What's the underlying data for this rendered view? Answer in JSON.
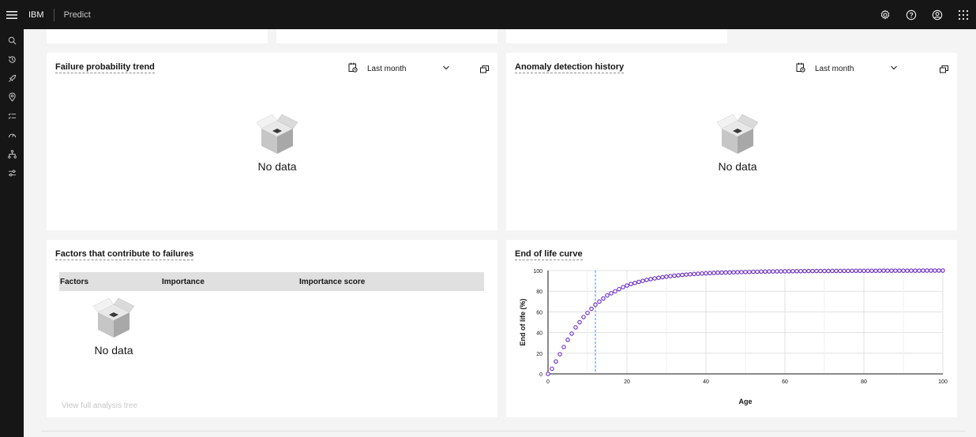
{
  "header": {
    "brand": "IBM",
    "product": "Predict",
    "menu_icon": "hamburger-menu-icon",
    "actions": [
      {
        "name": "settings-icon"
      },
      {
        "name": "help-icon"
      },
      {
        "name": "user-avatar-icon"
      },
      {
        "name": "app-switcher-icon"
      }
    ]
  },
  "sidenav": {
    "items": [
      {
        "icon": "search-icon"
      },
      {
        "icon": "recently-viewed-icon"
      },
      {
        "icon": "rocket-icon"
      },
      {
        "icon": "location-icon"
      },
      {
        "icon": "task-list-icon"
      },
      {
        "icon": "dashboard-gauge-icon"
      },
      {
        "icon": "hierarchy-icon"
      },
      {
        "icon": "settings-adjust-icon"
      }
    ]
  },
  "failure_trend": {
    "title": "Failure probability trend",
    "range": "Last month",
    "empty": "No data"
  },
  "anomaly_history": {
    "title": "Anomaly detection history",
    "range": "Last month",
    "empty": "No data"
  },
  "factors": {
    "title": "Factors that contribute to failures",
    "columns": [
      "Factors",
      "Importance",
      "Importance score"
    ],
    "empty": "No data",
    "link": "View full analysis tree"
  },
  "eol": {
    "title": "End of life curve"
  },
  "chart_data": {
    "type": "scatter",
    "title": "End of life curve",
    "xlabel": "Age",
    "ylabel": "End of life (%)",
    "xlim": [
      0,
      100
    ],
    "ylim": [
      0,
      100
    ],
    "xticks": [
      "0",
      "20",
      "40",
      "60",
      "80",
      "100"
    ],
    "yticks": [
      "0",
      "20",
      "40",
      "60",
      "80",
      "100"
    ],
    "grid": true,
    "point_color": "#6929c4",
    "marker_x": 12,
    "marker_color": "#4589ff",
    "series": [
      {
        "x": [
          0,
          1,
          2,
          3,
          4,
          5,
          6,
          7,
          8,
          9,
          10,
          11,
          12,
          13,
          14,
          15,
          16,
          17,
          18,
          19,
          20,
          21,
          22,
          23,
          24,
          25,
          26,
          27,
          28,
          29,
          30,
          31,
          32,
          33,
          34,
          35,
          36,
          37,
          38,
          39,
          40,
          41,
          42,
          43,
          44,
          45,
          46,
          47,
          48,
          49,
          50,
          51,
          52,
          53,
          54,
          55,
          56,
          57,
          58,
          59,
          60,
          61,
          62,
          63,
          64,
          65,
          66,
          67,
          68,
          69,
          70,
          71,
          72,
          73,
          74,
          75,
          76,
          77,
          78,
          79,
          80,
          81,
          82,
          83,
          84,
          85,
          86,
          87,
          88,
          89,
          90,
          91,
          92,
          93,
          94,
          95,
          96,
          97,
          98,
          99,
          100
        ],
        "values": [
          0,
          5,
          12,
          19,
          26,
          33,
          39,
          45,
          50,
          55,
          59,
          63,
          67,
          70,
          73,
          76,
          78,
          80,
          82,
          84,
          85.5,
          87,
          88,
          89,
          90,
          91,
          91.7,
          92.4,
          93,
          93.6,
          94.1,
          94.6,
          95,
          95.4,
          95.8,
          96.1,
          96.4,
          96.7,
          96.9,
          97.1,
          97.3,
          97.5,
          97.7,
          97.9,
          98,
          98.1,
          98.2,
          98.3,
          98.4,
          98.5,
          98.6,
          98.7,
          98.8,
          98.9,
          99,
          99,
          99.1,
          99.1,
          99.2,
          99.2,
          99.3,
          99.3,
          99.4,
          99.4,
          99.4,
          99.5,
          99.5,
          99.5,
          99.6,
          99.6,
          99.6,
          99.6,
          99.7,
          99.7,
          99.7,
          99.7,
          99.7,
          99.8,
          99.8,
          99.8,
          99.8,
          99.8,
          99.8,
          99.8,
          99.9,
          99.9,
          99.9,
          99.9,
          99.9,
          99.9,
          99.9,
          99.9,
          99.9,
          99.9,
          99.9,
          100,
          100,
          100,
          100,
          100,
          100
        ]
      }
    ]
  }
}
